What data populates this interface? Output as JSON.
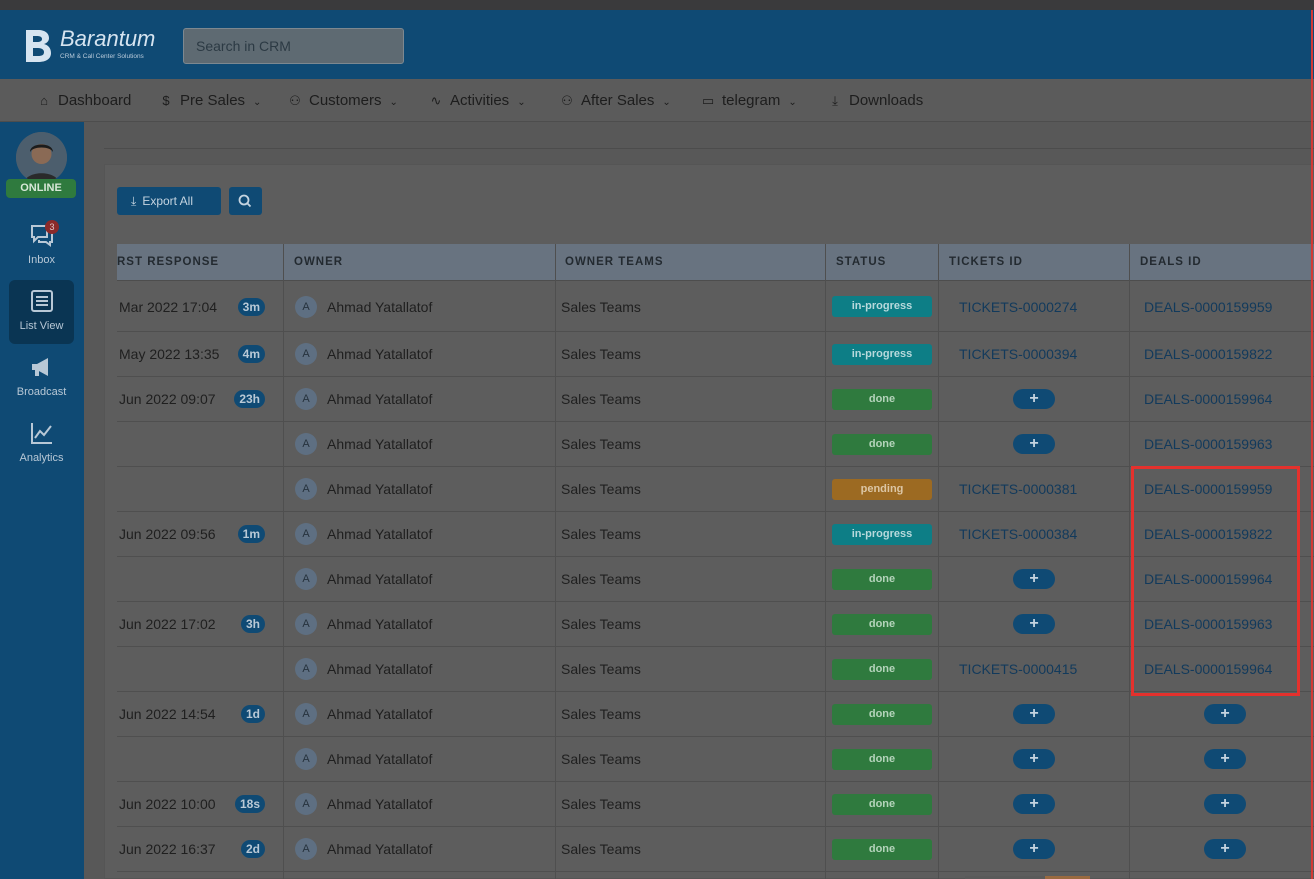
{
  "app": {
    "brand": "Barantum",
    "tagline": "CRM & Call Center Solutions",
    "search_placeholder": "Search in CRM"
  },
  "nav": [
    {
      "label": "Dashboard",
      "icon": "home-icon",
      "dropdown": false
    },
    {
      "label": "Pre Sales",
      "icon": "dollar-icon",
      "dropdown": true
    },
    {
      "label": "Customers",
      "icon": "users-icon",
      "dropdown": true
    },
    {
      "label": "Activities",
      "icon": "activity-icon",
      "dropdown": true
    },
    {
      "label": "After Sales",
      "icon": "user-group-icon",
      "dropdown": true
    },
    {
      "label": "telegram",
      "icon": "folder-icon",
      "dropdown": true
    },
    {
      "label": "Downloads",
      "icon": "download-icon",
      "dropdown": false
    }
  ],
  "sidebar": {
    "status": "ONLINE",
    "items": [
      {
        "label": "Inbox",
        "icon": "chat-icon",
        "badge": "3",
        "active": false
      },
      {
        "label": "List View",
        "icon": "list-icon",
        "active": true
      },
      {
        "label": "Broadcast",
        "icon": "megaphone-icon",
        "active": false
      },
      {
        "label": "Analytics",
        "icon": "chart-line-icon",
        "active": false
      }
    ]
  },
  "toolbar": {
    "export_label": "Export All",
    "search_icon": "search-icon"
  },
  "table": {
    "headers": [
      "RST RESPONSE",
      "OWNER",
      "OWNER TEAMS",
      "STATUS",
      "TICKETS ID",
      "DEALS ID"
    ],
    "rows": [
      {
        "date": "Mar 2022 17:04",
        "dur": "3m",
        "owner": "Ahmad Yatallatof",
        "team": "Sales Teams",
        "status": "in-progress",
        "ticket": "TICKETS-0000274",
        "deal": "DEALS-0000159959"
      },
      {
        "date": "May 2022 13:35",
        "dur": "4m",
        "owner": "Ahmad Yatallatof",
        "team": "Sales Teams",
        "status": "in-progress",
        "ticket": "TICKETS-0000394",
        "deal": "DEALS-0000159822"
      },
      {
        "date": "Jun 2022 09:07",
        "dur": "23h",
        "owner": "Ahmad Yatallatof",
        "team": "Sales Teams",
        "status": "done",
        "ticket": "",
        "deal": "DEALS-0000159964"
      },
      {
        "date": "",
        "dur": "",
        "owner": "Ahmad Yatallatof",
        "team": "Sales Teams",
        "status": "done",
        "ticket": "",
        "deal": "DEALS-0000159963"
      },
      {
        "date": "",
        "dur": "",
        "owner": "Ahmad Yatallatof",
        "team": "Sales Teams",
        "status": "pending",
        "ticket": "TICKETS-0000381",
        "deal": "DEALS-0000159959"
      },
      {
        "date": "Jun 2022 09:56",
        "dur": "1m",
        "owner": "Ahmad Yatallatof",
        "team": "Sales Teams",
        "status": "in-progress",
        "ticket": "TICKETS-0000384",
        "deal": "DEALS-0000159822"
      },
      {
        "date": "",
        "dur": "",
        "owner": "Ahmad Yatallatof",
        "team": "Sales Teams",
        "status": "done",
        "ticket": "",
        "deal": "DEALS-0000159964"
      },
      {
        "date": "Jun 2022 17:02",
        "dur": "3h",
        "owner": "Ahmad Yatallatof",
        "team": "Sales Teams",
        "status": "done",
        "ticket": "",
        "deal": "DEALS-0000159963"
      },
      {
        "date": "",
        "dur": "",
        "owner": "Ahmad Yatallatof",
        "team": "Sales Teams",
        "status": "done",
        "ticket": "TICKETS-0000415",
        "deal": "DEALS-0000159964"
      },
      {
        "date": "Jun 2022 14:54",
        "dur": "1d",
        "owner": "Ahmad Yatallatof",
        "team": "Sales Teams",
        "status": "done",
        "ticket": "",
        "deal": ""
      },
      {
        "date": "",
        "dur": "",
        "owner": "Ahmad Yatallatof",
        "team": "Sales Teams",
        "status": "done",
        "ticket": "",
        "deal": ""
      },
      {
        "date": "Jun 2022 10:00",
        "dur": "18s",
        "owner": "Ahmad Yatallatof",
        "team": "Sales Teams",
        "status": "done",
        "ticket": "",
        "deal": ""
      },
      {
        "date": "Jun 2022 16:37",
        "dur": "2d",
        "owner": "Ahmad Yatallatof",
        "team": "Sales Teams",
        "status": "done",
        "ticket": "",
        "deal": ""
      }
    ],
    "avatar_letter": "A",
    "add_symbol": "+"
  },
  "colors": {
    "brand": "#0f4a74",
    "highlight": "#e4312d",
    "status_done": "#2f7a3e",
    "status_progress": "#0d7e86",
    "status_pending": "#9c6a22"
  }
}
